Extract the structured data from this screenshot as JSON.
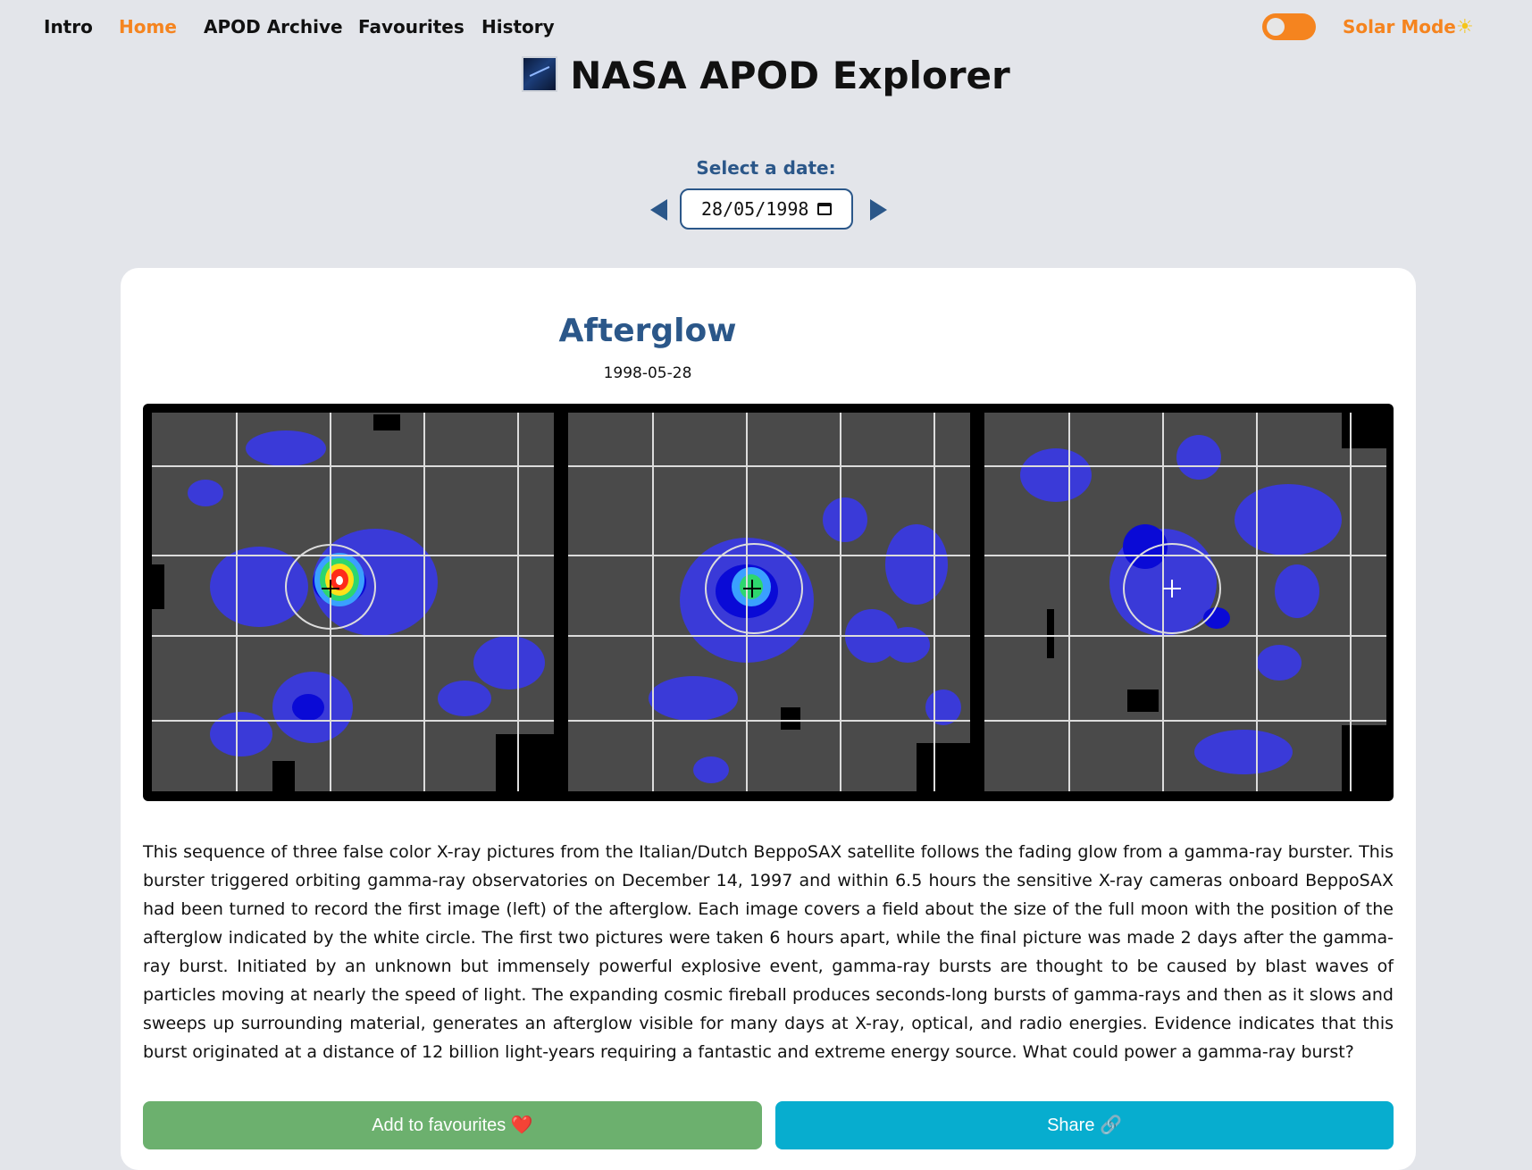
{
  "nav": {
    "items": [
      {
        "label": "Intro",
        "active": false
      },
      {
        "label": "Home",
        "active": true
      },
      {
        "label": "APOD Archive",
        "active": false
      },
      {
        "label": "Favourites",
        "active": false
      },
      {
        "label": "History",
        "active": false
      }
    ],
    "solar_mode_label": "Solar Mode",
    "solar_icon": "sun-icon"
  },
  "app": {
    "title": "NASA APOD Explorer",
    "title_icon": "galaxy-image-icon"
  },
  "date_picker": {
    "label": "Select a date:",
    "value": "28/05/1998",
    "prev_icon": "triangle-left",
    "next_icon": "triangle-right"
  },
  "apod": {
    "title": "Afterglow",
    "date": "1998-05-28",
    "explanation": "This sequence of three false color X-ray pictures from the Italian/Dutch BeppoSAX satellite follows the fading glow from a gamma-ray burster. This burster triggered orbiting gamma-ray observatories on December 14, 1997 and within 6.5 hours the sensitive X-ray cameras onboard BeppoSAX had been turned to record the first image (left) of the afterglow. Each image covers a field about the size of the full moon with the position of the afterglow indicated by the white circle. The first two pictures were taken 6 hours apart, while the final picture was made 2 days after the gamma-ray burst. Initiated by an unknown but immensely powerful explosive event, gamma-ray bursts are thought to be caused by blast waves of particles moving at nearly the speed of light. The expanding cosmic fireball produces seconds-long bursts of gamma-rays and then as it slows and sweeps up surrounding material, generates an afterglow visible for many days at X-ray, optical, and radio energies. Evidence indicates that this burst originated at a distance of 12 billion light-years requiring a fantastic and extreme energy source. What could power a gamma-ray burst?"
  },
  "actions": {
    "favourite_label": "Add to favourites",
    "favourite_icon": "❤️",
    "share_label": "Share",
    "share_icon": "🔗"
  },
  "colors": {
    "accent_orange": "#f5841f",
    "primary_blue": "#2b5789",
    "fav_green": "#6cb06e",
    "share_cyan": "#07adcf",
    "background": "#e3e5ea"
  }
}
